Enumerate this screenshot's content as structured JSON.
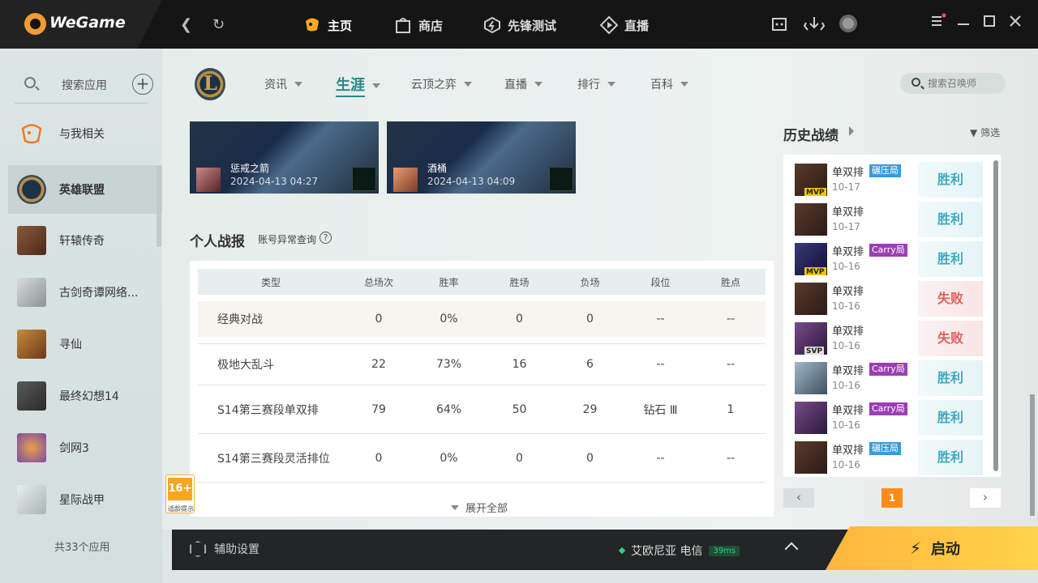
{
  "app": {
    "brand": "WeGame"
  },
  "topnav": {
    "items": [
      {
        "label": "主页",
        "icon": "gamepad-icon"
      },
      {
        "label": "商店",
        "icon": "shop-bag-icon"
      },
      {
        "label": "先锋测试",
        "icon": "pioneer-test-icon"
      },
      {
        "label": "直播",
        "icon": "live-icon"
      }
    ]
  },
  "sidebar": {
    "search_label": "搜索应用",
    "items": [
      {
        "label": "与我相关"
      },
      {
        "label": "英雄联盟"
      },
      {
        "label": "轩辕传奇"
      },
      {
        "label": "古剑奇谭网络..."
      },
      {
        "label": "寻仙"
      },
      {
        "label": "最终幻想14"
      },
      {
        "label": "剑网3"
      },
      {
        "label": "星际战甲"
      }
    ],
    "footer": "共33个应用"
  },
  "subnav": {
    "items": [
      "资讯",
      "生涯",
      "云顶之弈",
      "直播",
      "排行",
      "百科"
    ],
    "active": "生涯",
    "search_placeholder": "搜索召唤师"
  },
  "videos": [
    {
      "title": "惩戒之箭",
      "date": "2024-04-13 04:27"
    },
    {
      "title": "酒桶",
      "date": "2024-04-13 04:09"
    }
  ],
  "stats": {
    "title": "个人战报",
    "anomaly_link": "账号异常查询",
    "help": "?",
    "headers": [
      "类型",
      "总场次",
      "胜率",
      "胜场",
      "负场",
      "段位",
      "胜点"
    ],
    "rows": [
      [
        "经典对战",
        "0",
        "0%",
        "0",
        "0",
        "--",
        "--"
      ],
      [
        "极地大乱斗",
        "22",
        "73%",
        "16",
        "6",
        "--",
        "--"
      ],
      [
        "S14第三赛段单双排",
        "79",
        "64%",
        "50",
        "29",
        "钻石 Ⅲ",
        "1"
      ],
      [
        "S14第三赛段灵活排位",
        "0",
        "0%",
        "0",
        "0",
        "--",
        "--"
      ]
    ],
    "expand_label": "展开全部"
  },
  "age_badge": {
    "age": "16+",
    "hint": "适龄提示"
  },
  "history": {
    "title": "历史战绩",
    "filter_label": "筛选",
    "matches": [
      {
        "mode": "单双排",
        "tag": "碾压局",
        "badge": "MVP",
        "date": "10-17",
        "result": "胜利"
      },
      {
        "mode": "单双排",
        "tag": "",
        "badge": "",
        "date": "10-17",
        "result": "胜利"
      },
      {
        "mode": "单双排",
        "tag": "Carry局",
        "badge": "MVP",
        "date": "10-16",
        "result": "胜利"
      },
      {
        "mode": "单双排",
        "tag": "",
        "badge": "",
        "date": "10-16",
        "result": "失败"
      },
      {
        "mode": "单双排",
        "tag": "",
        "badge": "SVP",
        "date": "10-16",
        "result": "失败"
      },
      {
        "mode": "单双排",
        "tag": "Carry局",
        "badge": "",
        "date": "10-16",
        "result": "胜利"
      },
      {
        "mode": "单双排",
        "tag": "Carry局",
        "badge": "",
        "date": "10-16",
        "result": "胜利"
      },
      {
        "mode": "单双排",
        "tag": "碾压局",
        "badge": "",
        "date": "10-16",
        "result": "胜利"
      }
    ],
    "page": "1"
  },
  "bottombar": {
    "assist_label": "辅助设置",
    "server": "艾欧尼亚 电信",
    "ping": "39ms",
    "launch_label": "启动"
  },
  "colors": {
    "accent": "#268a85",
    "launch": "#ffc23e",
    "win": "#3aa9c4",
    "loss": "#e0605a",
    "page": "#ff8c1a"
  }
}
